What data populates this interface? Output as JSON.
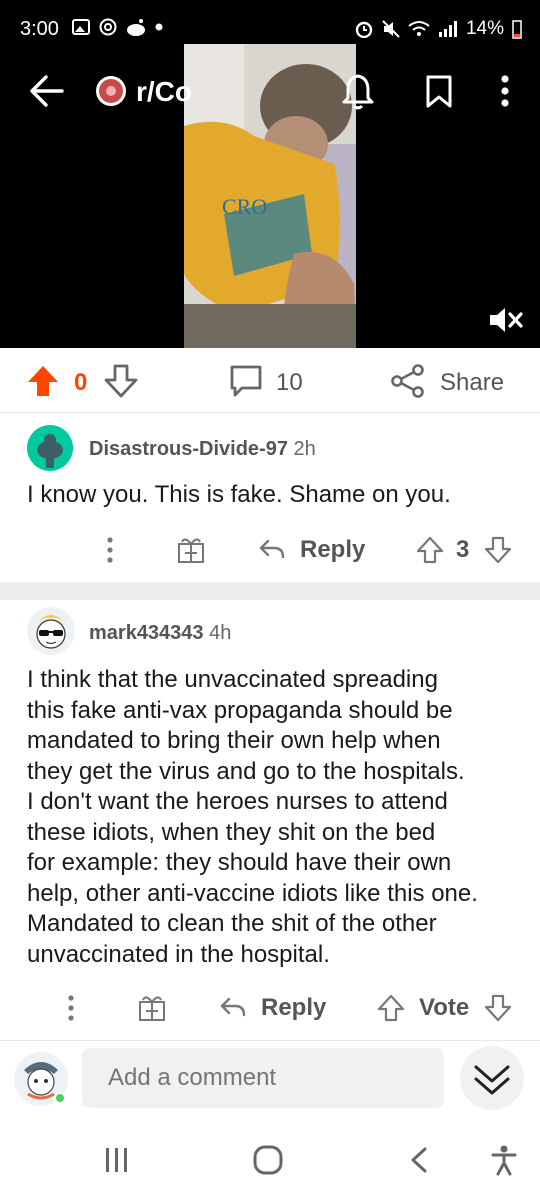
{
  "status_bar": {
    "time": "3:00",
    "battery": "14%"
  },
  "header": {
    "subreddit": "r/Co",
    "back_icon": "arrow-left-icon",
    "bell_icon": "bell-icon",
    "save_icon": "bookmark-icon",
    "more_icon": "vertical-dots-icon"
  },
  "video": {
    "shirt_text": "CRO",
    "muted_icon": "speaker-muted-icon"
  },
  "post_actions": {
    "score": "0",
    "comments": "10",
    "share_label": "Share"
  },
  "comments": [
    {
      "username": "Disastrous-Divide-97",
      "age": "2h",
      "body": "I know you. This is fake. Shame on you.",
      "reply_label": "Reply",
      "score": "3"
    },
    {
      "username": "mark434343",
      "age": "4h",
      "body_lines": [
        "I think that the unvaccinated spreading",
        "this fake anti-vax propaganda should be",
        "mandated to bring their own help when",
        "they get the virus and go to the hospitals.",
        "I don't want the heroes nurses to attend",
        "these idiots, when they shit on the bed",
        "for example: they should have their own",
        "help, other anti-vaccine idiots like this one.",
        "Mandated to clean the shit of the other",
        "unvaccinated in the hospital."
      ],
      "reply_label": "Reply",
      "vote_label": "Vote"
    }
  ],
  "composer": {
    "placeholder": "Add a comment"
  },
  "colors": {
    "upvote_active": "#ff4500",
    "text_muted": "#555555",
    "divider": "#ededed",
    "avatar_teal": "#00c9a0"
  }
}
